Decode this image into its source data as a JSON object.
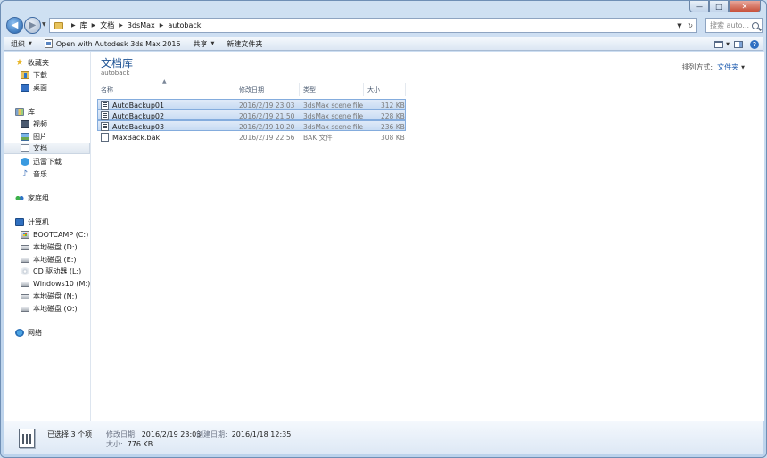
{
  "window": {
    "caption_buttons": [
      "—",
      "□",
      "✕"
    ]
  },
  "nav": {
    "breadcrumbs": [
      "库",
      "文档",
      "3dsMax",
      "autoback"
    ],
    "search_placeholder": "搜索 auto..."
  },
  "toolbar": {
    "organize": "组织",
    "open_with": "Open with Autodesk 3ds Max 2016",
    "share": "共享",
    "new_folder": "新建文件夹"
  },
  "sidebar": {
    "favorites": {
      "label": "收藏夹",
      "items": [
        "下载",
        "桌面"
      ]
    },
    "libraries": {
      "label": "库",
      "items": [
        "视频",
        "图片",
        "文档",
        "迅雷下载",
        "音乐"
      ]
    },
    "homegroup": {
      "label": "家庭组"
    },
    "computer": {
      "label": "计算机",
      "items": [
        "BOOTCAMP (C:)",
        "本地磁盘 (D:)",
        "本地磁盘 (E:)",
        "CD 驱动器 (L:)",
        "Windows10 (M:)",
        "本地磁盘 (N:)",
        "本地磁盘 (O:)"
      ]
    },
    "network": {
      "label": "网络"
    }
  },
  "main": {
    "library_title": "文档库",
    "library_subtitle": "autoback",
    "arrange_label": "排列方式:",
    "arrange_value": "文件夹",
    "columns": {
      "name": "名称",
      "modified": "修改日期",
      "type": "类型",
      "size": "大小"
    },
    "files": [
      {
        "name": "AutoBackup01",
        "modified": "2016/2/19 23:03",
        "type": "3dsMax scene file",
        "size": "312 KB",
        "selected": true
      },
      {
        "name": "AutoBackup02",
        "modified": "2016/2/19 21:50",
        "type": "3dsMax scene file",
        "size": "228 KB",
        "selected": true
      },
      {
        "name": "AutoBackup03",
        "modified": "2016/2/19 10:20",
        "type": "3dsMax scene file",
        "size": "236 KB",
        "selected": true
      },
      {
        "name": "MaxBack.bak",
        "modified": "2016/2/19 22:56",
        "type": "BAK 文件",
        "size": "308 KB",
        "selected": false
      }
    ]
  },
  "details": {
    "selection_count": "已选择 3 个项",
    "modified_label": "修改日期:",
    "modified_value": "2016/2/19 23:03",
    "created_label": "创建日期:",
    "created_value": "2016/1/18 12:35",
    "size_label": "大小:",
    "size_value": "776 KB"
  }
}
